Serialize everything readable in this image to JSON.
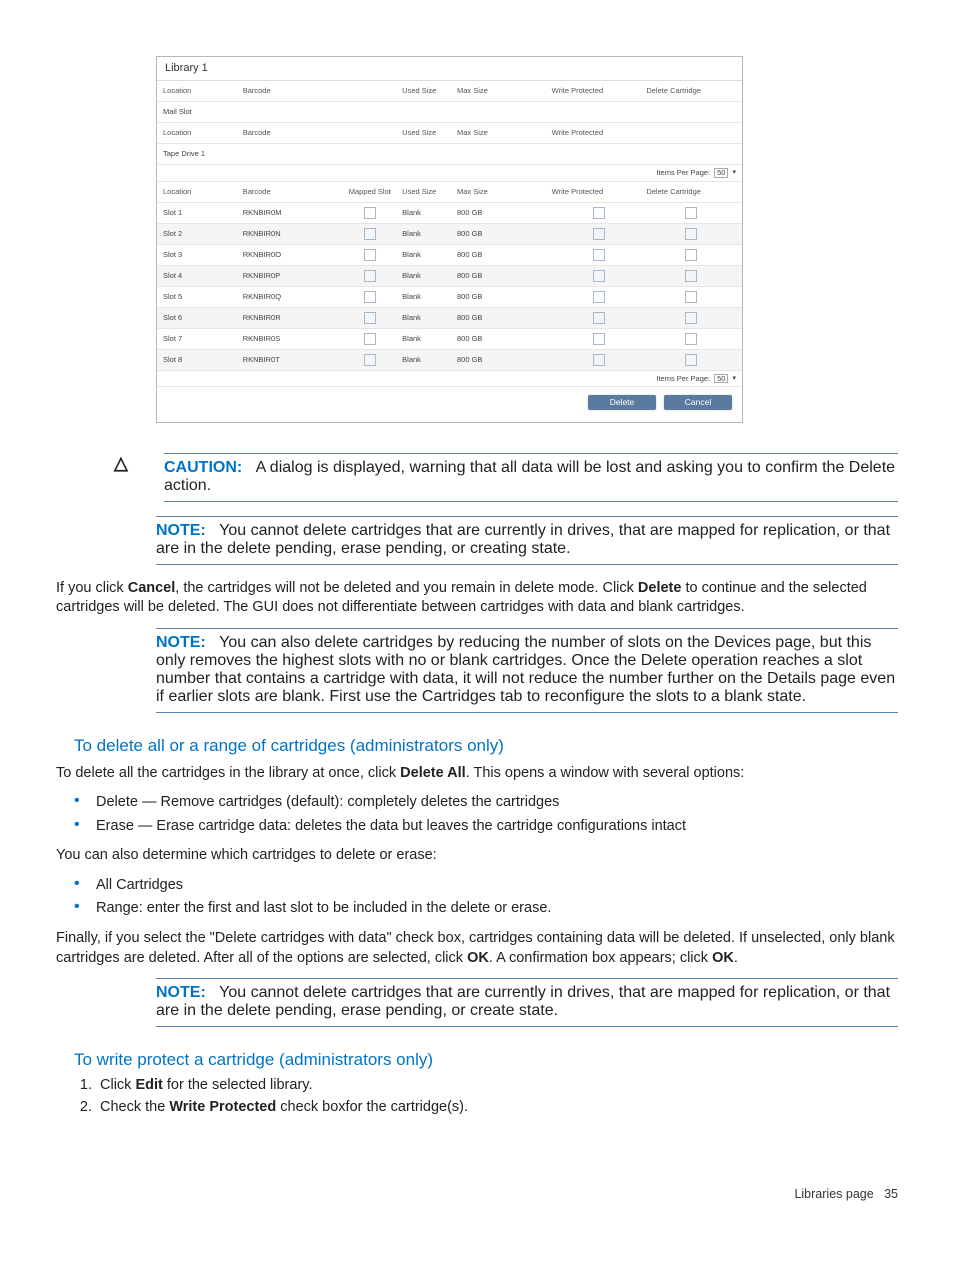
{
  "screenshot": {
    "title": "Library 1",
    "items_per_page_label": "Items Per Page:",
    "items_per_page_value": "50",
    "headers_top": {
      "location": "Location",
      "barcode": "Barcode",
      "used_size": "Used Size",
      "max_size": "Max Size",
      "write_protected": "Write Protected",
      "delete_cartridge": "Delete Cartridge"
    },
    "mail_slot_label": "Mail Slot",
    "tape_drive_label": "Tape Drive 1",
    "headers_slots": {
      "location": "Location",
      "barcode": "Barcode",
      "mapped_slot": "Mapped Slot",
      "used_size": "Used Size",
      "max_size": "Max Size",
      "write_protected": "Write Protected",
      "delete_cartridge": "Delete Cartridge"
    },
    "rows": [
      {
        "slot": "Slot 1",
        "barcode": "RKNBIR0M",
        "used": "Blank",
        "max": "800 GB"
      },
      {
        "slot": "Slot 2",
        "barcode": "RKNBIR0N",
        "used": "Blank",
        "max": "800 GB"
      },
      {
        "slot": "Slot 3",
        "barcode": "RKNBIR0O",
        "used": "Blank",
        "max": "800 GB"
      },
      {
        "slot": "Slot 4",
        "barcode": "RKNBIR0P",
        "used": "Blank",
        "max": "800 GB"
      },
      {
        "slot": "Slot 5",
        "barcode": "RKNBIR0Q",
        "used": "Blank",
        "max": "800 GB"
      },
      {
        "slot": "Slot 6",
        "barcode": "RKNBIR0R",
        "used": "Blank",
        "max": "800 GB"
      },
      {
        "slot": "Slot 7",
        "barcode": "RKNBIR0S",
        "used": "Blank",
        "max": "800 GB"
      },
      {
        "slot": "Slot 8",
        "barcode": "RKNBIR0T",
        "used": "Blank",
        "max": "800 GB"
      }
    ],
    "delete_btn": "Delete",
    "cancel_btn": "Cancel"
  },
  "caution": {
    "label": "CAUTION:",
    "text": "A dialog is displayed, warning that all data will be lost and asking you to confirm the Delete action."
  },
  "note1": {
    "label": "NOTE:",
    "text": "You cannot delete cartridges that are currently in drives, that are mapped for replication, or that are in the delete pending, erase pending, or creating state."
  },
  "cancel_para": {
    "p1a": "If you click ",
    "cancel": "Cancel",
    "p1b": ", the cartridges will not be deleted and you remain in delete mode. Click ",
    "delete": "Delete",
    "p1c": " to continue and the selected cartridges will be deleted. The GUI does not differentiate between cartridges with data and blank cartridges."
  },
  "note2": {
    "label": "NOTE:",
    "text": "You can also delete cartridges by reducing the number of slots on the Devices page, but this only removes the highest slots with no or blank cartridges. Once the Delete operation reaches a slot number that contains a cartridge with data, it will not reduce the number further on the Details page even if earlier slots are blank. First use the Cartridges tab to reconfigure the slots to a blank state."
  },
  "heading_delete_all": "To delete all or a range of cartridges (administrators only)",
  "delete_all_intro": {
    "a": "To delete all the cartridges in the library at once, click ",
    "bold": "Delete All",
    "b": ". This opens a window with several options:"
  },
  "bullets1": [
    "Delete — Remove cartridges (default): completely deletes the cartridges",
    "Erase — Erase cartridge data: deletes the data but leaves the cartridge configurations intact"
  ],
  "determine_line": "You can also determine which cartridges to delete or erase:",
  "bullets2": [
    "All Cartridges",
    "Range: enter the first and last slot to be included in the delete or erase."
  ],
  "finally_para": {
    "a": "Finally, if you select the \"Delete cartridges with data\" check box, cartridges containing data will be deleted. If unselected, only blank cartridges are deleted. After all of the options are selected, click ",
    "ok1": "OK",
    "b": ". A confirmation box appears; click ",
    "ok2": "OK",
    "c": "."
  },
  "note3": {
    "label": "NOTE:",
    "text": "You cannot delete cartridges that are currently in drives, that are mapped for replication, or that are in the delete pending, erase pending, or create state."
  },
  "heading_write_protect": "To write protect a cartridge (administrators only)",
  "steps": {
    "s1a": "Click ",
    "s1bold": "Edit",
    "s1b": " for the selected library.",
    "s2a": "Check the ",
    "s2bold": "Write Protected",
    "s2b": " check boxfor the cartridge(s)."
  },
  "footer": {
    "section": "Libraries page",
    "page": "35"
  }
}
